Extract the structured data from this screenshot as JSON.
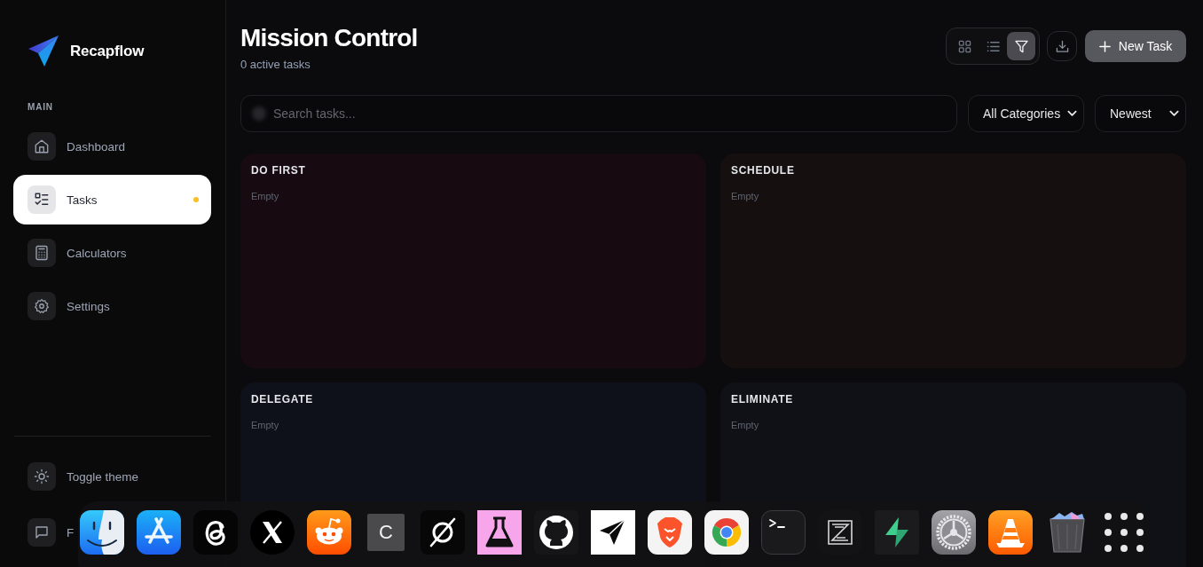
{
  "sidebar": {
    "brand": "Recapflow",
    "section": "MAIN",
    "nav": [
      {
        "label": "Dashboard",
        "selected": false,
        "dot": false
      },
      {
        "label": "Tasks",
        "selected": true,
        "dot": true
      },
      {
        "label": "Calculators",
        "selected": false,
        "dot": false
      },
      {
        "label": "Settings",
        "selected": false,
        "dot": false
      }
    ],
    "footer": [
      {
        "label": "Toggle theme"
      },
      {
        "label": "F"
      }
    ]
  },
  "header": {
    "title": "Mission Control",
    "subtitle": "0 active tasks",
    "view_buttons": [
      {
        "selected": false
      },
      {
        "selected": false
      },
      {
        "selected": true
      }
    ],
    "new_task_button": "New Task"
  },
  "filters": {
    "search": {
      "placeholder": "Search tasks..."
    },
    "category_select": "All Categories",
    "sort_select": "Newest"
  },
  "quadrants": [
    {
      "title": "DO FIRST",
      "color": "#170a11",
      "empty_text": "Empty"
    },
    {
      "title": "SCHEDULE",
      "color": "#15100f",
      "empty_text": "Empty"
    },
    {
      "title": "DELEGATE",
      "color": "#0e111a",
      "empty_text": "Empty"
    },
    {
      "title": "ELIMINATE",
      "color": "#0f1116",
      "empty_text": "Empty"
    }
  ],
  "dock": {
    "letter_tile": "C"
  }
}
